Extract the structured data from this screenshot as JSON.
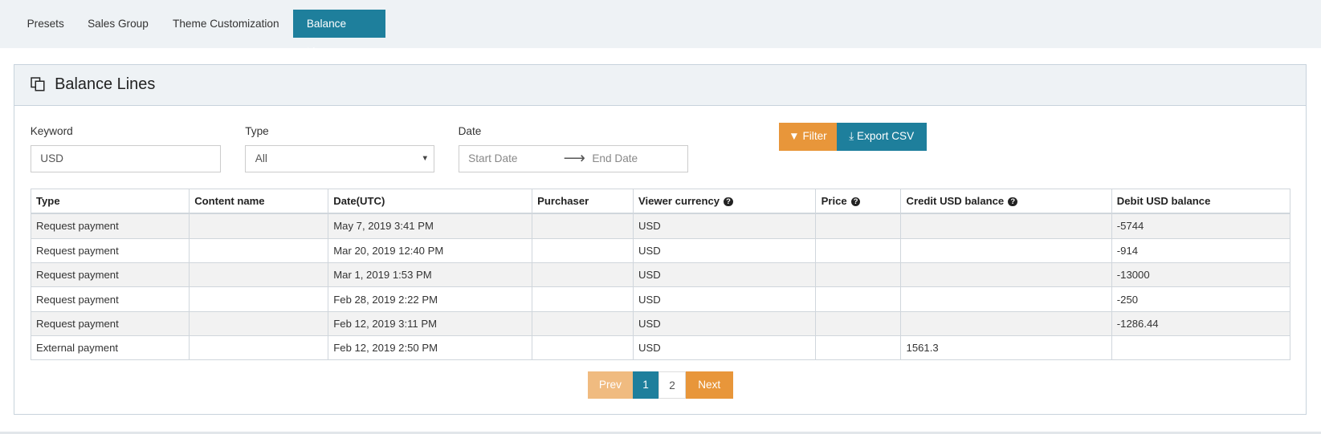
{
  "tabs": [
    {
      "label": "Presets"
    },
    {
      "label": "Sales Group"
    },
    {
      "label": "Theme Customization"
    },
    {
      "label": "Balance Lines"
    }
  ],
  "panel": {
    "title": "Balance Lines",
    "icon": "copy-icon"
  },
  "filters": {
    "keyword_label": "Keyword",
    "keyword_value": "USD",
    "type_label": "Type",
    "type_value": "All",
    "date_label": "Date",
    "start_placeholder": "Start Date",
    "end_placeholder": "End Date"
  },
  "buttons": {
    "filter": "Filter",
    "export": "Export CSV"
  },
  "colors": {
    "teal": "#1e7f9c",
    "orange": "#e8963a",
    "orange_light": "#f0bb80"
  },
  "table": {
    "headers": [
      "Type",
      "Content name",
      "Date(UTC)",
      "Purchaser",
      "Viewer currency",
      "Price",
      "Credit USD balance",
      "Debit USD balance"
    ],
    "rows": [
      [
        "Request payment",
        "",
        "May 7, 2019 3:41 PM",
        "",
        "USD",
        "",
        "",
        "-5744"
      ],
      [
        "Request payment",
        "",
        "Mar 20, 2019 12:40 PM",
        "",
        "USD",
        "",
        "",
        "-914"
      ],
      [
        "Request payment",
        "",
        "Mar 1, 2019 1:53 PM",
        "",
        "USD",
        "",
        "",
        "-13000"
      ],
      [
        "Request payment",
        "",
        "Feb 28, 2019 2:22 PM",
        "",
        "USD",
        "",
        "",
        "-250"
      ],
      [
        "Request payment",
        "",
        "Feb 12, 2019 3:11 PM",
        "",
        "USD",
        "",
        "",
        "-1286.44"
      ],
      [
        "External payment",
        "",
        "Feb 12, 2019 2:50 PM",
        "",
        "USD",
        "",
        "1561.3",
        ""
      ]
    ]
  },
  "pagination": {
    "prev": "Prev",
    "pages": [
      "1",
      "2"
    ],
    "current": "1",
    "next": "Next"
  }
}
